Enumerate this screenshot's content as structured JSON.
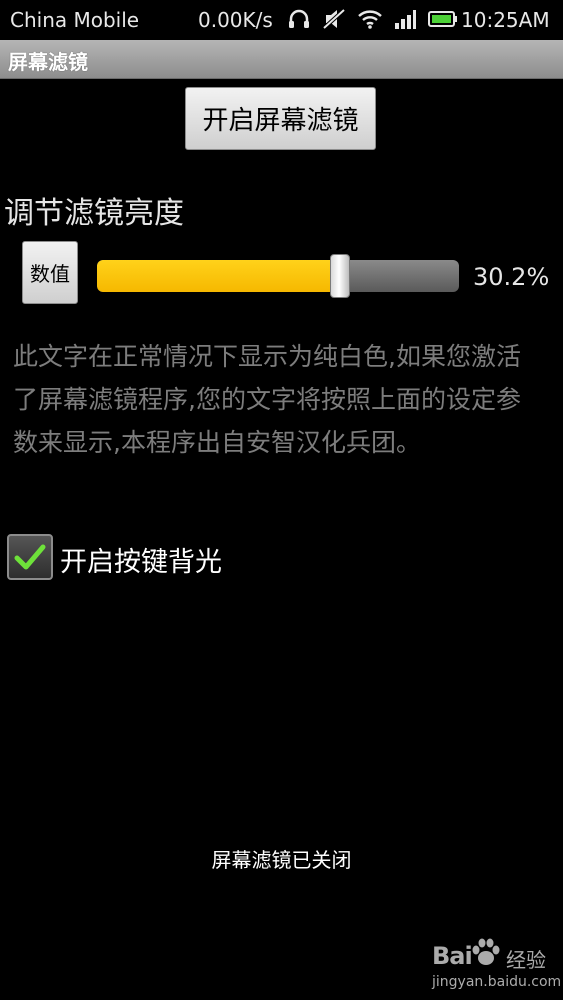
{
  "status_bar": {
    "carrier": "China Mobile",
    "net_speed": "0.00K/s",
    "time": "10:25AM",
    "icons": [
      "headphones-icon",
      "mute-icon",
      "wifi-icon",
      "signal-icon",
      "battery-icon"
    ],
    "battery_color": "#4cd137"
  },
  "title_bar": {
    "title": "屏幕滤镜"
  },
  "main": {
    "toggle_button_label": "开启屏幕滤镜",
    "brightness_label": "调节滤镜亮度",
    "value_button_label": "数值",
    "slider": {
      "value": 0.302,
      "display": "30.2%",
      "fill_color": "#f6b800"
    },
    "description": "此文字在正常情况下显示为纯白色,如果您激活了屏幕滤镜程序,您的文字将按照上面的设定参数来显示,本程序出自安智汉化兵团。",
    "backlight_checkbox": {
      "label": "开启按键背光",
      "checked": true,
      "check_color": "#6ee23a"
    },
    "status_message": "屏幕滤镜已关闭"
  },
  "watermark": {
    "brand": "Bai",
    "brand_suffix": "经验",
    "url": "jingyan.baidu.com"
  }
}
